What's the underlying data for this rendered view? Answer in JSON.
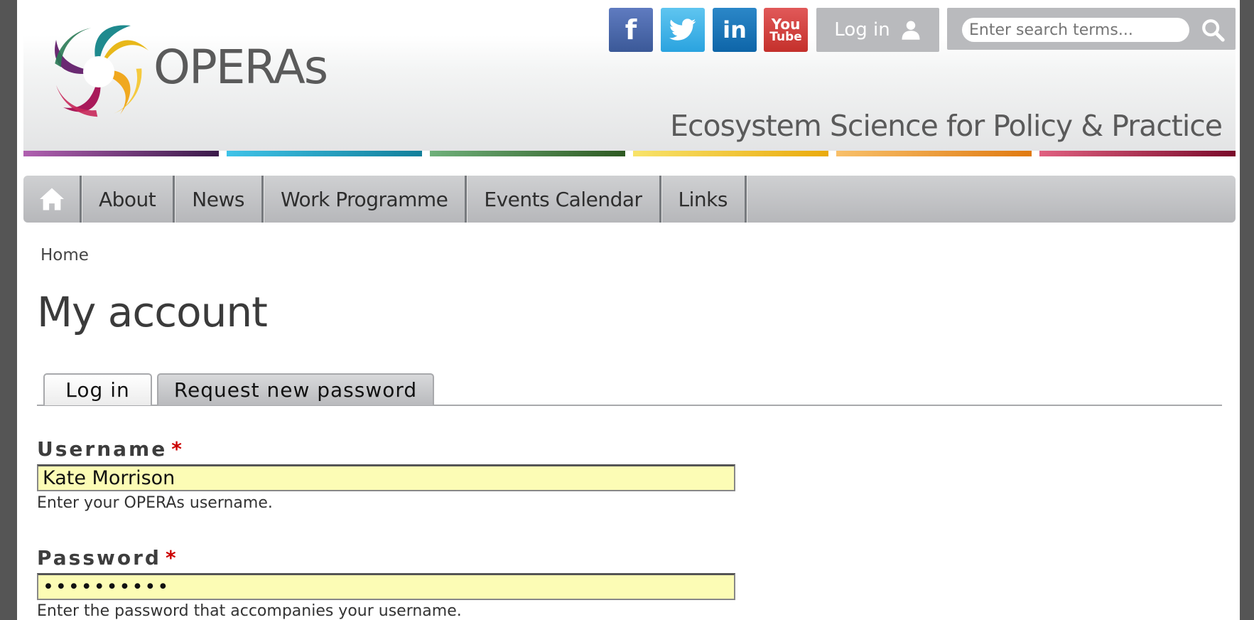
{
  "colors": {
    "frame": "#555555",
    "accent_required": "#cc0000",
    "input_autofill": "#fcfcb5",
    "stripes": [
      "#5c2a6b",
      "#1fa3c9",
      "#3f7e3a",
      "#f4c21a",
      "#f09a1a",
      "#a31d48"
    ]
  },
  "site": {
    "name": "OPERAs",
    "tagline": "Ecosystem Science for Policy & Practice",
    "logo_icon": "swirl-logo-icon"
  },
  "social": [
    {
      "name": "facebook",
      "glyph": "f"
    },
    {
      "name": "twitter",
      "glyph": ""
    },
    {
      "name": "linkedin",
      "glyph": "in"
    },
    {
      "name": "youtube",
      "glyph_top": "You",
      "glyph_bottom": "Tube"
    }
  ],
  "header": {
    "login_label": "Log in",
    "search_placeholder": "Enter search terms..."
  },
  "nav": {
    "items": [
      {
        "label": "About"
      },
      {
        "label": "News"
      },
      {
        "label": "Work Programme"
      },
      {
        "label": "Events Calendar"
      },
      {
        "label": "Links"
      }
    ]
  },
  "breadcrumb": "Home",
  "page_title": "My account",
  "tabs": [
    {
      "label": "Log in",
      "active": true
    },
    {
      "label": "Request new password",
      "active": false
    }
  ],
  "form": {
    "username": {
      "label": "Username",
      "required_mark": "*",
      "value": "Kate Morrison",
      "help": "Enter your OPERAs username."
    },
    "password": {
      "label": "Password",
      "required_mark": "*",
      "value": "••••••••••",
      "help": "Enter the password that accompanies your username."
    }
  }
}
